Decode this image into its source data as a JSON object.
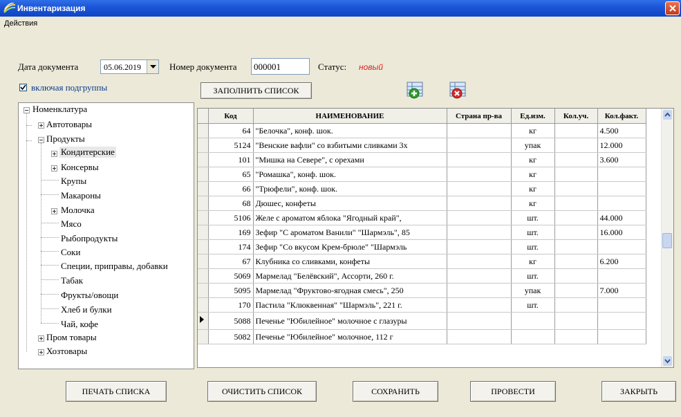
{
  "window": {
    "title": "Инвентаризация"
  },
  "menu": {
    "actions": "Действия"
  },
  "header": {
    "date_label": "Дата документа",
    "date_value": "05.06.2019",
    "number_label": "Номер документа",
    "number_value": "000001",
    "status_label": "Статус:",
    "status_value": "новый"
  },
  "options": {
    "include_subgroups_label": "включая подгруппы",
    "include_subgroups_checked": true
  },
  "buttons": {
    "fill_list": "ЗАПОЛНИТЬ СПИСОК",
    "print_list": "ПЕЧАТЬ СПИСКА",
    "clear_list": "ОЧИСТИТЬ СПИСОК",
    "save": "СОХРАНИТЬ",
    "post": "ПРОВЕСТИ",
    "close": "ЗАКРЫТЬ"
  },
  "tree": {
    "root": "Номенклатура",
    "items": [
      "Автотовары",
      "Продукты",
      "Кондитерские",
      "Консервы",
      "Крупы",
      "Макароны",
      "Молочка",
      "Мясо",
      "Рыбопродукты",
      "Соки",
      "Специи, приправы, добавки",
      "Табак",
      "Фрукты/овощи",
      "Хлеб и булки",
      "Чай, кофе",
      "Пром товары",
      "Хозтовары"
    ]
  },
  "table": {
    "columns": [
      "Код",
      "НАИМЕНОВАНИЕ",
      "Страна пр-ва",
      "Ед.изм.",
      "Кол.уч.",
      "Кол.факт."
    ],
    "rows": [
      {
        "code": "64",
        "name": "\"Белочка\", конф. шок.",
        "unit": "кг",
        "fact": "4.500"
      },
      {
        "code": "5124",
        "name": "\"Венские вафли\" со взбитыми сливками 3х",
        "unit": "упак",
        "fact": "12.000"
      },
      {
        "code": "101",
        "name": "\"Мишка на Севере\", с орехами",
        "unit": "кг",
        "fact": "3.600"
      },
      {
        "code": "65",
        "name": "\"Ромашка\", конф. шок.",
        "unit": "кг",
        "fact": ""
      },
      {
        "code": "66",
        "name": "\"Трюфели\", конф. шок.",
        "unit": "кг",
        "fact": ""
      },
      {
        "code": "68",
        "name": "Дюшес, конфеты",
        "unit": "кг",
        "fact": ""
      },
      {
        "code": "5106",
        "name": "Желе с ароматом яблока \"Ягодный край\",",
        "unit": "шт.",
        "fact": "44.000"
      },
      {
        "code": "169",
        "name": "Зефир \"С ароматом Ванили\" \"Шармэль\", 85",
        "unit": "шт.",
        "fact": "16.000"
      },
      {
        "code": "174",
        "name": "Зефир \"Со вкусом Крем-брюле\" \"Шармэль",
        "unit": "шт.",
        "fact": ""
      },
      {
        "code": "67",
        "name": "Клубника со сливками, конфеты",
        "unit": "кг",
        "fact": "6.200"
      },
      {
        "code": "5069",
        "name": "Мармелад \"Белёвский\", Ассорти, 260 г.",
        "unit": "шт.",
        "fact": ""
      },
      {
        "code": "5095",
        "name": "Мармелад \"Фруктово-ягодная смесь\", 250",
        "unit": "упак",
        "fact": "7.000"
      },
      {
        "code": "170",
        "name": "Пастила \"Клюквенная\" \"Шармэль\", 221 г.",
        "unit": "шт.",
        "fact": ""
      },
      {
        "code": "5088",
        "name": "Печенье \"Юбилейное\" молочное с глазуры",
        "unit": "",
        "fact": ""
      },
      {
        "code": "5082",
        "name": "Печенье \"Юбилейное\" молочное, 112 г",
        "unit": "",
        "fact": ""
      }
    ]
  },
  "icons": {
    "add": "add-row-icon",
    "remove": "remove-row-icon",
    "app": "app-icon"
  },
  "colors": {
    "title_blue": "#1b54d6",
    "status_red": "#e02020",
    "link_blue": "#0b3a8c"
  }
}
